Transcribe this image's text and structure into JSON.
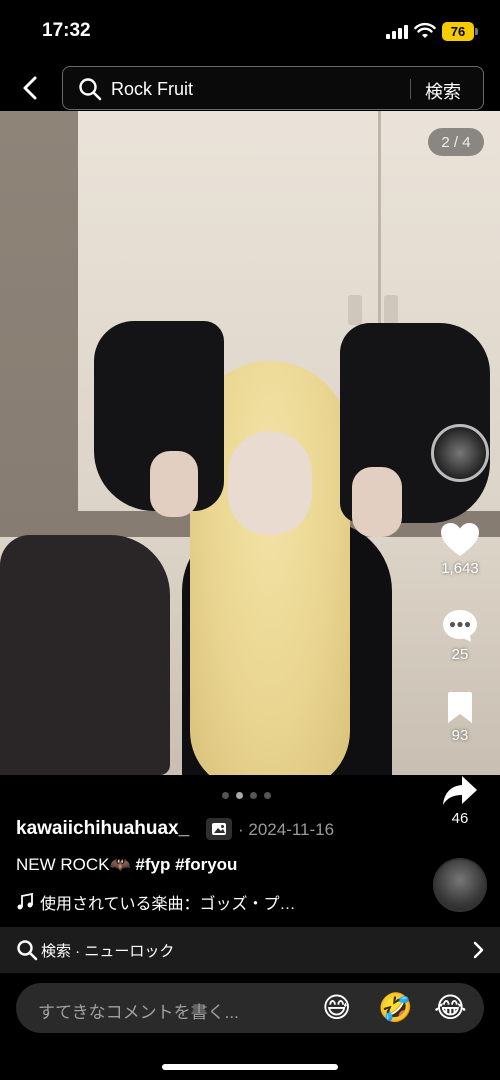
{
  "status_bar": {
    "time": "17:32",
    "battery": "76"
  },
  "header": {
    "search_query": "Rock Fruit",
    "search_button": "検索"
  },
  "post": {
    "page_indicator": "2 / 4",
    "author": "kawaiichihuahuax_",
    "date": "· 2024-11-16",
    "caption_text": "NEW ROCK🦇",
    "caption_tags": "#fyp #foryou",
    "music": "使用されている楽曲：ゴッズ・プ…"
  },
  "actions": {
    "likes": "1,643",
    "comments": "25",
    "saves": "93",
    "shares": "46"
  },
  "related_search": {
    "label": "検索 · ニューロック"
  },
  "comment_bar": {
    "placeholder": "すてきなコメントを書く...",
    "emojis": [
      "😅",
      "🤣",
      "😂"
    ]
  },
  "icons": [
    "back-icon",
    "search-icon",
    "heart-icon",
    "comment-icon",
    "bookmark-icon",
    "share-icon",
    "music-note-icon",
    "chevron-right-icon",
    "photo-icon"
  ]
}
